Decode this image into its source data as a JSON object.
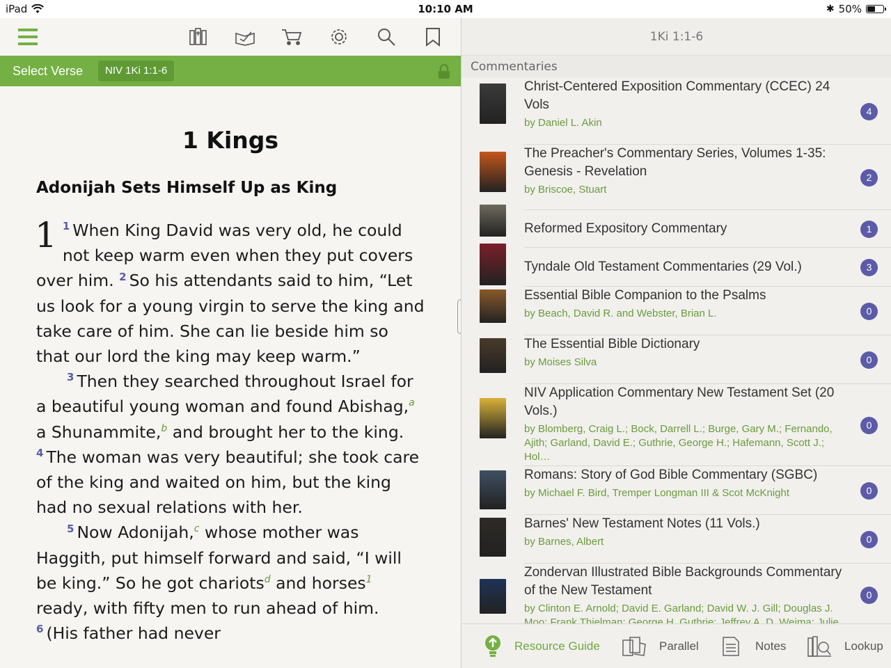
{
  "status_bar": {
    "device": "iPad",
    "time": "10:10 AM",
    "battery": "50%",
    "battery_level": 0.5
  },
  "toolbar": {
    "icons": [
      "menu-icon",
      "library-icon",
      "reading-plan-icon",
      "cart-icon",
      "settings-icon",
      "search-icon",
      "bookmark-icon"
    ]
  },
  "verse_bar": {
    "select_label": "Select Verse",
    "reference": "NIV 1Ki 1:1-6"
  },
  "scripture": {
    "book_title": "1 Kings",
    "heading": "Adonijah Sets Himself Up as King",
    "chapter": "1",
    "v1_num": "1",
    "v1": "When King David was very old, he could not keep warm even when they put covers over him.",
    "v2_num": "2",
    "v2": "So his attendants said to him, “Let us look for a young virgin to serve the king and take care of him. She can lie beside him so that our lord the king may keep warm.”",
    "v3_num": "3",
    "v3a": "Then they searched throughout Israel for a beautiful young woman and found Abishag,",
    "fn_a": "a",
    "v3b": " a Shunammite,",
    "fn_b": "b",
    "v3c": " and brought her to the king.",
    "v4_num": "4",
    "v4": "The woman was very beautiful; she took care of the king and waited on him, but the king had no sexual relations with her.",
    "v5_num": "5",
    "v5a": "Now Adonijah,",
    "fn_c": "c",
    "v5b": " whose mother was Haggith, put himself forward and said, “I will be king.” So he got chariots",
    "fn_d": "d",
    "v5c": " and horses",
    "fn_1": "1",
    "v5d": " ready, with fifty men to run ahead of him.",
    "v6_num": "6",
    "v6": "(His father had never"
  },
  "right_panel": {
    "header": "1Ki 1:1-6",
    "section": "Commentaries",
    "items": [
      {
        "title": "Christ-Centered Exposition Commentary (CCEC) 24 Vols",
        "author": "by Daniel L. Akin",
        "count": "4",
        "cover": "#3a3a3a"
      },
      {
        "title": "The Preacher's Commentary Series, Volumes 1-35: Genesis - Revelation",
        "author": "by Briscoe, Stuart",
        "count": "2",
        "cover": "#c4571c"
      },
      {
        "title": "Reformed Expository Commentary",
        "author": "",
        "count": "1",
        "cover": "#6f6a5e"
      },
      {
        "title": "Tyndale Old Testament Commentaries (29 Vol.)",
        "author": "",
        "count": "3",
        "cover": "#7a1f2a"
      },
      {
        "title": "Essential Bible Companion to the Psalms",
        "author": "by Beach, David R. and Webster, Brian L.",
        "count": "0",
        "cover": "#8a5a2a"
      },
      {
        "title": "The Essential Bible Dictionary",
        "author": "by Moises Silva",
        "count": "0",
        "cover": "#4a3a2a"
      },
      {
        "title": "NIV Application Commentary New Testament Set (20 Vols.)",
        "author": "by Blomberg, Craig L.; Bock, Darrell L.; Burge, Gary M.; Fernando, Ajith; Garland, David E.; Guthrie, George H.; Hafemann, Scott J.; Hol…",
        "count": "0",
        "cover": "#d8b23a"
      },
      {
        "title": "Romans: Story of God Bible Commentary (SGBC)",
        "author": "by Michael F. Bird, Tremper Longman III & Scot McKnight",
        "count": "0",
        "cover": "#3f4f63"
      },
      {
        "title": "Barnes' New Testament Notes (11 Vols.)",
        "author": "by Barnes, Albert",
        "count": "0",
        "cover": "#2e2a26"
      },
      {
        "title": "Zondervan Illustrated Bible Backgrounds Commentary of the New Testament",
        "author": "by Clinton E. Arnold; David E. Garland; David W. J. Gill; Douglas J. Moo; Frank Thielman; George H. Guthrie; Jeffrey A. D. Weima; Julie",
        "count": "0",
        "cover": "#1e3358"
      }
    ]
  },
  "tabs": {
    "resource_guide": "Resource Guide",
    "parallel": "Parallel",
    "notes": "Notes",
    "lookup": "Lookup"
  },
  "colors": {
    "accent_green": "#74b043",
    "badge_purple": "#5c5ba8",
    "author_green": "#6b9b3d"
  }
}
